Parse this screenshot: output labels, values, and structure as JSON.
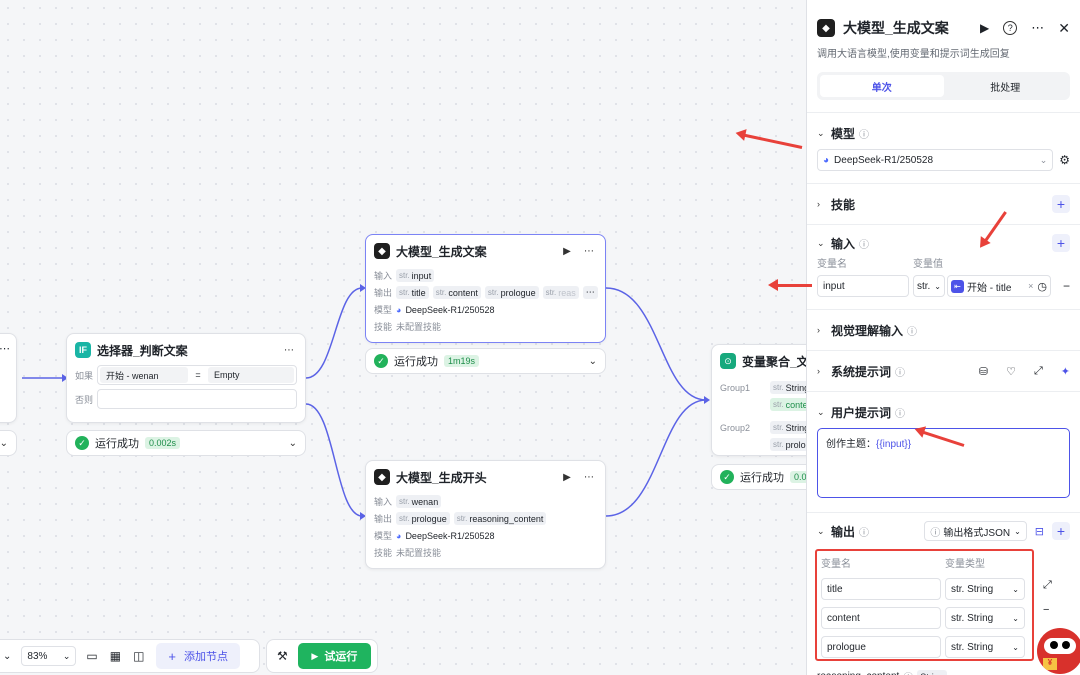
{
  "canvas": {
    "left_card_more": "⋯",
    "selector": {
      "title": "选择器_判断文案",
      "if_label": "如果",
      "if_var": "开始 - wenan",
      "if_op": "=",
      "if_value": "Empty",
      "else_label": "否则",
      "status_text": "运行成功",
      "status_time": "0.002s"
    },
    "llm1": {
      "title": "大模型_生成文案",
      "input_label": "输入",
      "output_label": "输出",
      "model_label": "模型",
      "skills_label": "技能",
      "inputs": [
        "input"
      ],
      "outputs": [
        "title",
        "content",
        "prologue",
        "reas"
      ],
      "model": "DeepSeek-R1/250528",
      "skills": "未配置技能",
      "status_text": "运行成功",
      "status_time": "1m19s"
    },
    "llm2": {
      "title": "大模型_生成开头",
      "input_label": "输入",
      "output_label": "输出",
      "model_label": "模型",
      "skills_label": "技能",
      "inputs": [
        "wenan"
      ],
      "outputs": [
        "prologue",
        "reasoning_content"
      ],
      "model": "DeepSeek-R1/250528",
      "skills": "未配置技能"
    },
    "aggregator": {
      "title": "变量聚合_文案",
      "group1": "Group1",
      "group2": "Group2",
      "g1_vars": [
        "String",
        "conte"
      ],
      "g2_vars": [
        "String",
        "prolog"
      ],
      "status_text": "运行成功",
      "status_time": "0.00"
    },
    "type_str": "str.",
    "toolbar": {
      "zoom": "83%",
      "add_node": "添加节点",
      "run": "试运行"
    }
  },
  "panel": {
    "title": "大模型_生成文案",
    "desc": "调用大语言模型,使用变量和提示词生成回复",
    "tabs": [
      "单次",
      "批处理"
    ],
    "model_section": "模型",
    "model_value": "DeepSeek-R1/250528",
    "skills_section": "技能",
    "input_section": "输入",
    "var_name_header": "变量名",
    "var_value_header": "变量值",
    "input_name": "input",
    "input_type": "str.",
    "input_ref": "开始 - title",
    "vision_section": "视觉理解输入",
    "system_prompt_section": "系统提示词",
    "user_prompt_section": "用户提示词",
    "user_prompt_text": "创作主题：",
    "user_prompt_var": "{{input}}",
    "output_section": "输出",
    "output_format": "输出格式JSON",
    "out_name_header": "变量名",
    "out_type_header": "变量类型",
    "outputs": [
      {
        "name": "title",
        "type": "str. String"
      },
      {
        "name": "content",
        "type": "str. String"
      },
      {
        "name": "prologue",
        "type": "str. String"
      }
    ],
    "reasoning_label": "reasoning_content",
    "reasoning_type": "String"
  },
  "colors": {
    "accent": "#4d53e8",
    "success": "#22b25b",
    "annotation": "#e8413a"
  }
}
